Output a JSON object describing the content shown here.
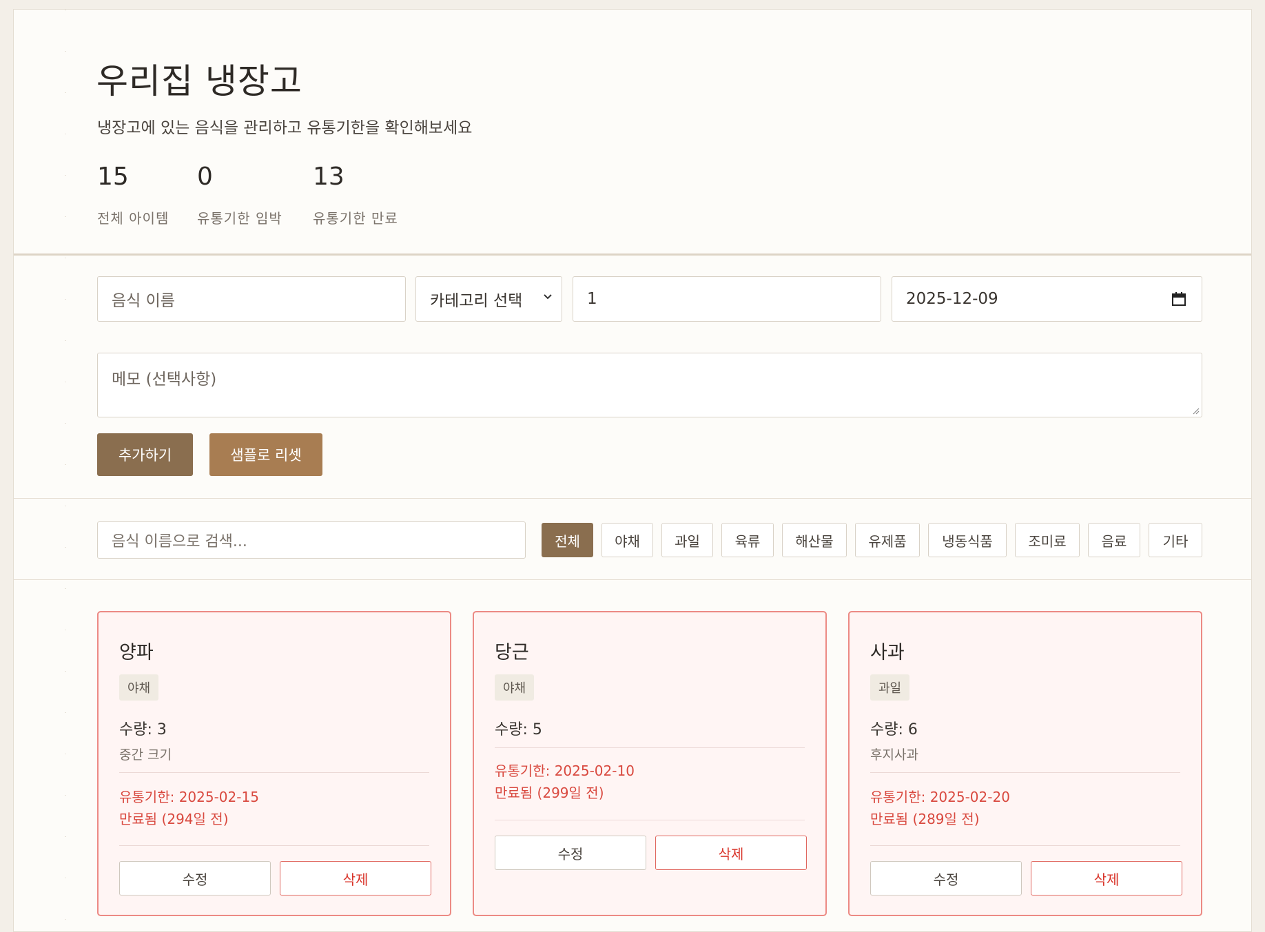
{
  "header": {
    "title": "우리집 냉장고",
    "subtitle": "냉장고에 있는 음식을 관리하고 유통기한을 확인해보세요",
    "stats": [
      {
        "value": "15",
        "label": "전체 아이템"
      },
      {
        "value": "0",
        "label": "유통기한 임박"
      },
      {
        "value": "13",
        "label": "유통기한 만료"
      }
    ]
  },
  "form": {
    "name_placeholder": "음식 이름",
    "category_select": "카테고리 선택",
    "quantity_value": "1",
    "date_value": "2025-12-09",
    "memo_placeholder": "메모 (선택사항)",
    "add_label": "추가하기",
    "reset_label": "샘플로 리셋",
    "colors": {
      "add": "#8a6e4f",
      "reset": "#a87d52"
    }
  },
  "filter": {
    "search_placeholder": "음식 이름으로 검색...",
    "categories": [
      "전체",
      "야채",
      "과일",
      "육류",
      "해산물",
      "유제품",
      "냉동식품",
      "조미료",
      "음료",
      "기타"
    ],
    "active": "전체"
  },
  "items": [
    {
      "name": "양파",
      "category": "야채",
      "quantity": "수량: 3",
      "memo": "중간 크기",
      "expiry": "유통기한: 2025-02-15",
      "status": "만료됨 (294일 전)",
      "edit": "수정",
      "delete": "삭제"
    },
    {
      "name": "당근",
      "category": "야채",
      "quantity": "수량: 5",
      "memo": "",
      "expiry": "유통기한: 2025-02-10",
      "status": "만료됨 (299일 전)",
      "edit": "수정",
      "delete": "삭제"
    },
    {
      "name": "사과",
      "category": "과일",
      "quantity": "수량: 6",
      "memo": "후지사과",
      "expiry": "유통기한: 2025-02-20",
      "status": "만료됨 (289일 전)",
      "edit": "수정",
      "delete": "삭제"
    }
  ]
}
